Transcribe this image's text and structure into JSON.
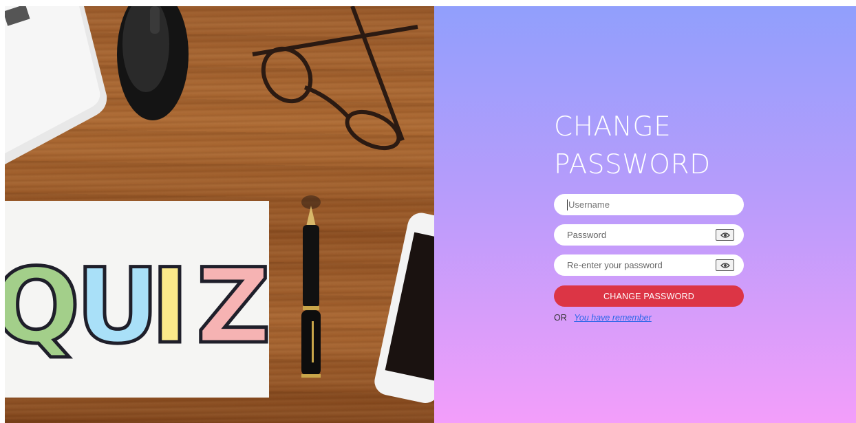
{
  "hero": {
    "quiz_letters": [
      "Q",
      "U",
      "I",
      "Z"
    ],
    "quiz_colors": [
      "#8fc37a",
      "#8ed7f5",
      "#f7e26b",
      "#f3a1a1"
    ]
  },
  "form": {
    "title_line1": "CHANGE",
    "title_line2": "PASSWORD",
    "username_placeholder": "Username",
    "password_placeholder": "Password",
    "reenter_placeholder": "Re-enter your password",
    "eye_icon": "eye-icon",
    "submit_label": "CHANGE PASSWORD",
    "or_text": "OR",
    "remember_link": "You have remember"
  },
  "colors": {
    "gradient_top": "#919ffc",
    "gradient_bottom": "#f39efa",
    "submit": "#dc3545",
    "link": "#2a66e8"
  }
}
